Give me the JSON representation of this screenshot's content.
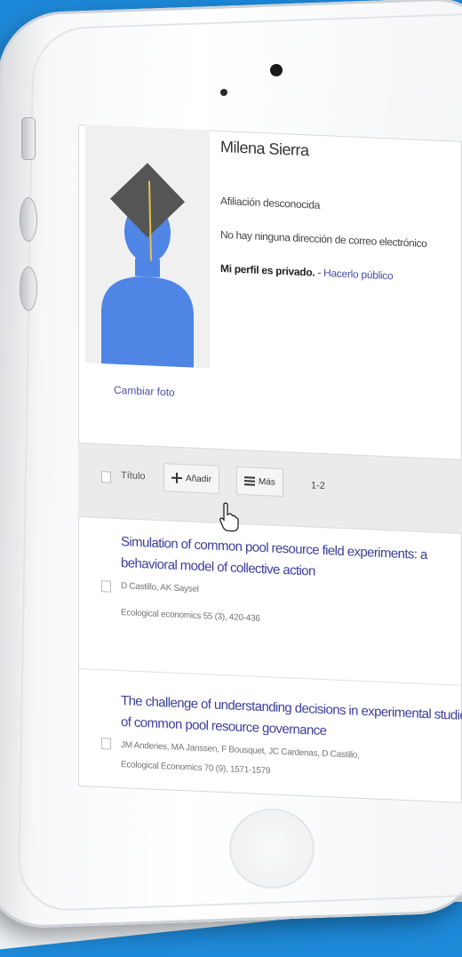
{
  "profile": {
    "name": "Milena Sierra",
    "affiliation": "Afiliación desconocida",
    "email_status": "No hay ninguna dirección de correo electrónico",
    "privacy_label": "Mi perfil es privado.",
    "privacy_separator": " - ",
    "privacy_link": "Hacerlo público",
    "change_photo": "Cambiar foto"
  },
  "toolbar": {
    "title_label": "Título",
    "add_label": "Añadir",
    "more_label": "Más",
    "range": "1-2"
  },
  "articles": [
    {
      "title": "Simulation of common pool resource field experiments: a behavioral model of collective action",
      "authors": "D Castillo, AK Saysel",
      "venue": "Ecological economics 55 (3), 420-436"
    },
    {
      "title": "The challenge of understanding decisions in experimental studies of common pool resource governance",
      "authors": "JM Anderies, MA Janssen, F Bousquet, JC Cardenas, D Castillo,",
      "venue": "Ecological Economics 70 (9), 1571-1579"
    }
  ],
  "icons": {
    "avatar": "graduate-avatar-icon",
    "add": "plus-icon",
    "more": "menu-lines-icon",
    "cursor": "hand-pointer-icon"
  },
  "colors": {
    "link": "#4a4fa8",
    "avatar_body": "#4f86e6",
    "cap": "#555555"
  }
}
